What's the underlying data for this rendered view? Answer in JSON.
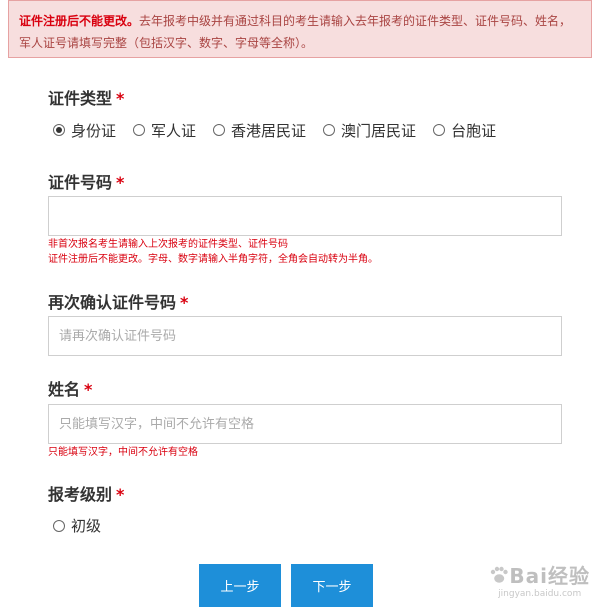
{
  "notice": {
    "bold_text": "证件注册后不能更改。",
    "text": "去年报考中级并有通过科目的考生请输入去年报考的证件类型、证件号码、姓名，军人证号请填写完整（包括汉字、数字、字母等全称）。"
  },
  "id_type": {
    "label": "证件类型",
    "required_mark": "*",
    "options": [
      "身份证",
      "军人证",
      "香港居民证",
      "澳门居民证",
      "台胞证"
    ],
    "selected": "身份证"
  },
  "id_number": {
    "label": "证件号码",
    "required_mark": "*",
    "value": "",
    "hint_line1": "非首次报名考生请输入上次报考的证件类型、证件号码",
    "hint_line2": "证件注册后不能更改。字母、数字请输入半角字符，全角会自动转为半角。"
  },
  "id_confirm": {
    "label": "再次确认证件号码",
    "required_mark": "*",
    "placeholder": "请再次确认证件号码"
  },
  "name": {
    "label": "姓名",
    "required_mark": "*",
    "placeholder": "只能填写汉字，中间不允许有空格",
    "hint": "只能填写汉字，中间不允许有空格"
  },
  "level": {
    "label": "报考级别",
    "required_mark": "*",
    "option": "初级"
  },
  "buttons": {
    "prev": "上一步",
    "next": "下一步"
  },
  "watermark": {
    "brand": "Bai经验",
    "url": "jingyan.baidu.com"
  }
}
